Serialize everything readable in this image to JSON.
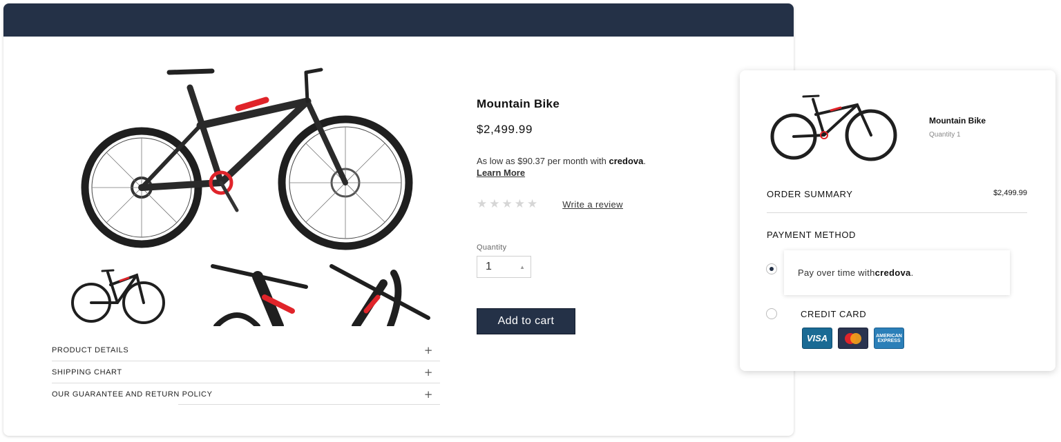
{
  "product": {
    "title": "Mountain Bike",
    "price": "$2,499.99",
    "financing_prefix": "As low as $90.37 per month with ",
    "credova": "credova",
    "financing_suffix": ".",
    "learn_more": "Learn More",
    "write_review": "Write a review",
    "rating_stars": 0,
    "quantity_label": "Quantity",
    "quantity_value": "1",
    "add_to_cart": "Add to cart"
  },
  "accordion": [
    {
      "label": "PRODUCT DETAILS",
      "icon": "+"
    },
    {
      "label": "SHIPPING CHART",
      "icon": "+"
    },
    {
      "label": "OUR GUARANTEE AND RETURN POLICY",
      "icon": "+"
    }
  ],
  "checkout": {
    "product_name": "Mountain Bike",
    "quantity_text": "Quantity 1",
    "order_summary": "ORDER SUMMARY",
    "order_total": "$2,499.99",
    "payment_method": "PAYMENT METHOD",
    "credova_option_prefix": "Pay over time with ",
    "credova": "credova",
    "credova_option_suffix": ".",
    "credit_card": "CREDIT CARD",
    "cards": [
      {
        "name": "visa",
        "label": "VISA"
      },
      {
        "name": "mastercard"
      },
      {
        "name": "amex",
        "label_line1": "AMERICAN",
        "label_line2": "EXPRESS"
      }
    ]
  },
  "colors": {
    "header": "#243147",
    "button": "#243147",
    "bike_frame": "#2a2a2a",
    "bike_accent": "#e0242a"
  }
}
